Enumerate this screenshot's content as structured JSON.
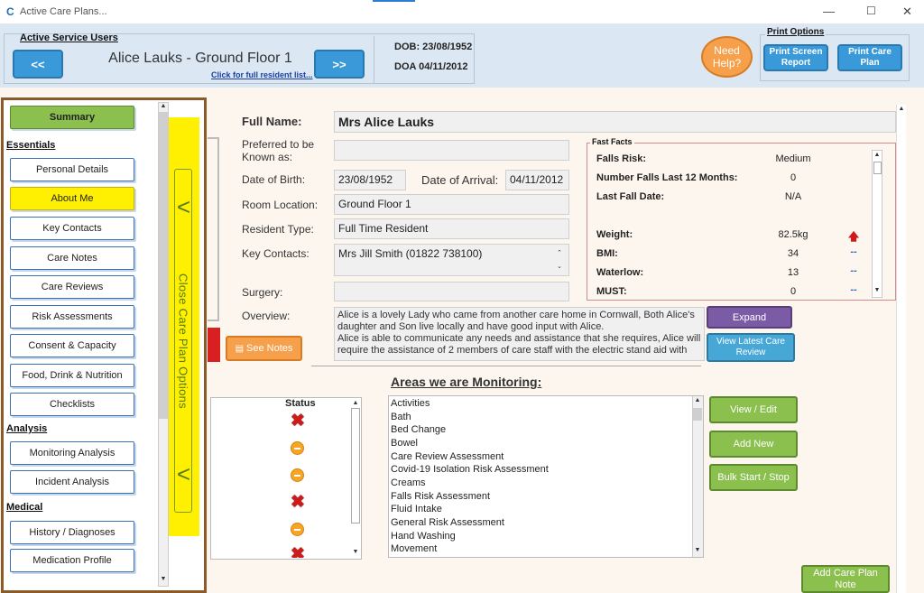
{
  "window": {
    "title": "Active Care Plans...",
    "controls": {
      "minimize": "—",
      "maximize": "☐",
      "close": "✕"
    }
  },
  "header": {
    "section_label": "Active Service Users",
    "prev_label": "<<",
    "next_label": ">>",
    "resident_name": "Alice Lauks - Ground Floor 1",
    "full_list_link": "Click for full resident list...",
    "dob": "DOB: 23/08/1952",
    "doa": "DOA 04/11/2012",
    "need_help": "Need Help?",
    "print_options_label": "Print Options",
    "print_screen_report": "Print Screen Report",
    "print_care_plan": "Print Care Plan"
  },
  "sidebar": {
    "summary": "Summary",
    "sections": {
      "essentials": "Essentials",
      "analysis": "Analysis",
      "medical": "Medical"
    },
    "items": {
      "personal_details": "Personal Details",
      "about_me": "About Me",
      "key_contacts": "Key Contacts",
      "care_notes": "Care Notes",
      "care_reviews": "Care Reviews",
      "risk_assessments": "Risk Assessments",
      "consent_capacity": "Consent & Capacity",
      "food_drink": "Food, Drink & Nutrition",
      "checklists": "Checklists",
      "monitoring_analysis": "Monitoring Analysis",
      "incident_analysis": "Incident Analysis",
      "history_diagnoses": "History / Diagnoses",
      "medication_profile": "Medication Profile"
    },
    "active_item": "About Me",
    "close_options": "Close Care Plan Options"
  },
  "form": {
    "full_name_label": "Full Name:",
    "full_name": "Mrs Alice Lauks",
    "preferred_label": "Preferred to be Known as:",
    "preferred_value": "",
    "dob_label": "Date of Birth:",
    "dob_value": "23/08/1952",
    "doa_label": "Date of Arrival:",
    "doa_value": "04/11/2012",
    "room_label": "Room Location:",
    "room_value": "Ground Floor 1",
    "type_label": "Resident Type:",
    "type_value": "Full Time Resident",
    "contacts_label": "Key Contacts:",
    "contacts_value": "Mrs Jill Smith (01822 738100)",
    "surgery_label": "Surgery:",
    "surgery_value": "",
    "overview_label": "Overview:",
    "overview_value": "Alice is a lovely Lady who came from another care home in Cornwall, Both Alice's daughter and Son live locally and have good input with Alice.\nAlice is able to communicate any needs and assistance that she requires, Alice will require the assistance of 2 members of care staff with the electric stand aid with",
    "see_notes": "See Notes",
    "expand": "Expand",
    "view_latest_review": "View Latest Care Review"
  },
  "fast_facts": {
    "title": "Fast Facts",
    "rows": [
      {
        "label": "Falls Risk:",
        "value": "Medium",
        "indicator": ""
      },
      {
        "label": "Number Falls Last 12 Months:",
        "value": "0",
        "indicator": ""
      },
      {
        "label": "Last Fall Date:",
        "value": "N/A",
        "indicator": ""
      },
      {
        "label": "Weight:",
        "value": "82.5kg",
        "indicator": "up-arrow"
      },
      {
        "label": "BMI:",
        "value": "34",
        "indicator": "--"
      },
      {
        "label": "Waterlow:",
        "value": "13",
        "indicator": "--"
      },
      {
        "label": "MUST:",
        "value": "0",
        "indicator": "--"
      }
    ],
    "colors": {
      "up": "#d01919",
      "neutral": "#2b6fc2"
    }
  },
  "monitoring": {
    "title": "Areas we are Monitoring:",
    "status_header": "Status",
    "statuses": [
      "cross",
      "dash",
      "dash",
      "cross",
      "dash",
      "cross"
    ],
    "areas": [
      "Activities",
      "Bath",
      "Bed Change",
      "Bowel",
      "Care Review Assessment",
      "Covid-19 Isolation Risk Assessment",
      "Creams",
      "Falls Risk Assessment",
      "Fluid Intake",
      "General Risk Assessment",
      "Hand Washing",
      "Movement"
    ],
    "view_edit": "View / Edit",
    "add_new": "Add New",
    "bulk_start_stop": "Bulk Start / Stop",
    "add_care_plan_note": "Add Care Plan Note"
  }
}
